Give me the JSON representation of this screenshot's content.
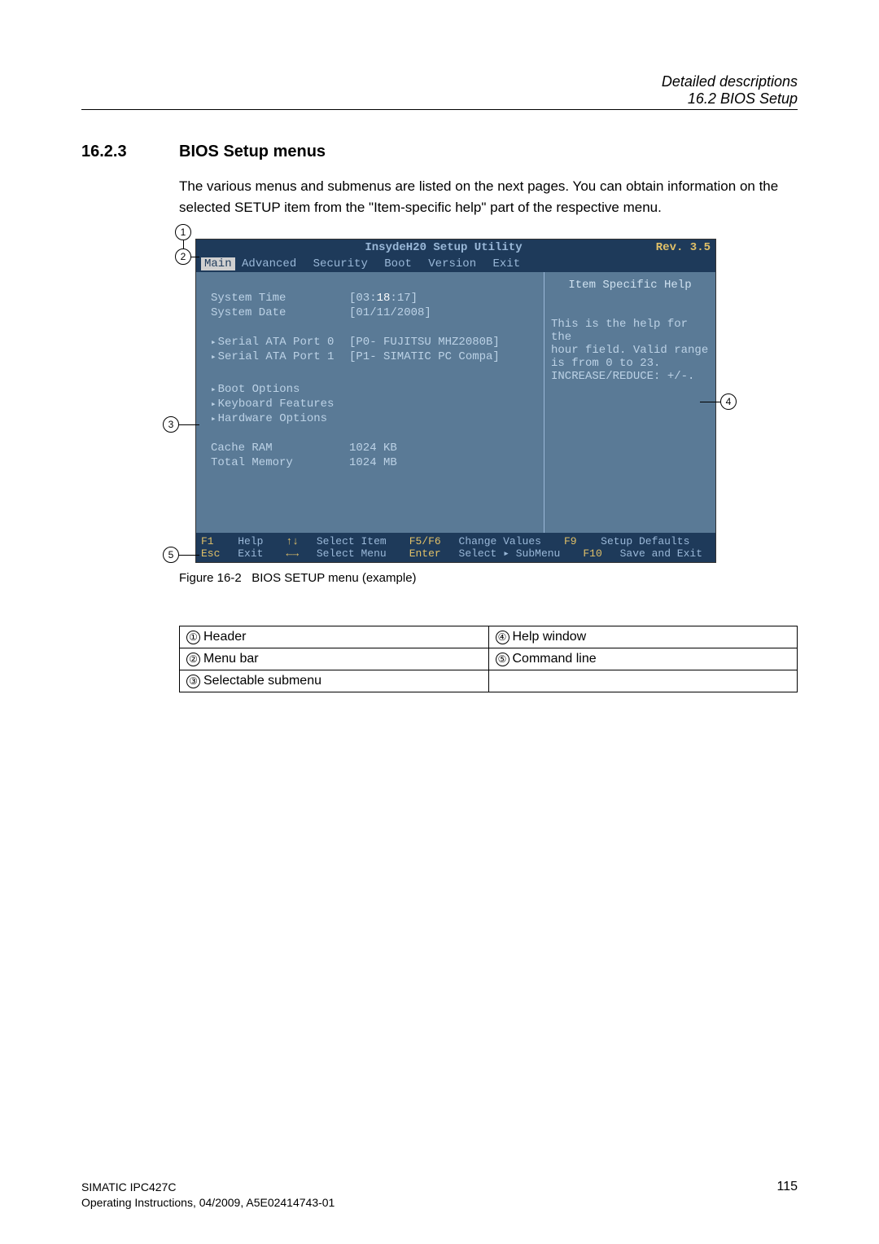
{
  "header": {
    "chapter": "Detailed descriptions",
    "section": "16.2 BIOS Setup"
  },
  "sec": {
    "num": "16.2.3",
    "title": "BIOS Setup menus",
    "body": "The various menus and submenus are listed on the next pages. You can obtain information on the selected SETUP item from the \"Item-specific help\" part of the respective menu."
  },
  "bios": {
    "title": "InsydeH20 Setup Utility",
    "rev": "Rev. 3.5",
    "menu": {
      "active": "Main",
      "items": [
        "Advanced",
        "Security",
        "Boot",
        "Version",
        "Exit"
      ]
    },
    "rows": {
      "time_label": "System Time",
      "time_val": "[03:18:17]",
      "date_label": "System Date",
      "date_val": "[01/11/2008]",
      "p0_label": "Serial ATA Port 0",
      "p0_val": "[P0- FUJITSU MHZ2080B]",
      "p1_label": "Serial ATA Port 1",
      "p1_val": "[P1- SIMATIC PC Compa]",
      "boot": "Boot Options",
      "kbd": "Keyboard Features",
      "hw": "Hardware Options",
      "cache_label": "Cache RAM",
      "cache_val": "1024 KB",
      "mem_label": "Total Memory",
      "mem_val": "1024 MB"
    },
    "help": {
      "title": "Item Specific Help",
      "l1": "This is the help for the",
      "l2": "hour field. Valid range",
      "l3": "is from 0 to 23.",
      "l4": "INCREASE/REDUCE: +/-."
    },
    "foot": {
      "f1": "F1",
      "f1t": "Help",
      "ud": "↑↓",
      "udt": "Select Item",
      "f56": "F5/F6",
      "f56t": "Change Values",
      "f9": "F9",
      "f9t": "Setup Defaults",
      "esc": "Esc",
      "esct": "Exit",
      "lr": "←→",
      "lrt": "Select Menu",
      "ent": "Enter",
      "entt": "Select ▸ SubMenu",
      "f10": "F10",
      "f10t": "Save and Exit"
    }
  },
  "figure": {
    "num": "Figure 16-2",
    "cap": "BIOS SETUP menu (example)"
  },
  "legend": {
    "r1a": "Header",
    "r1b": "Help window",
    "r2a": "Menu bar",
    "r2b": "Command line",
    "r3a": "Selectable submenu"
  },
  "callouts": {
    "c1": "1",
    "c2": "2",
    "c3": "3",
    "c4": "4",
    "c5": "5"
  },
  "footer": {
    "l1": "SIMATIC IPC427C",
    "l2": "Operating Instructions, 04/2009, A5E02414743-01",
    "pg": "115"
  }
}
